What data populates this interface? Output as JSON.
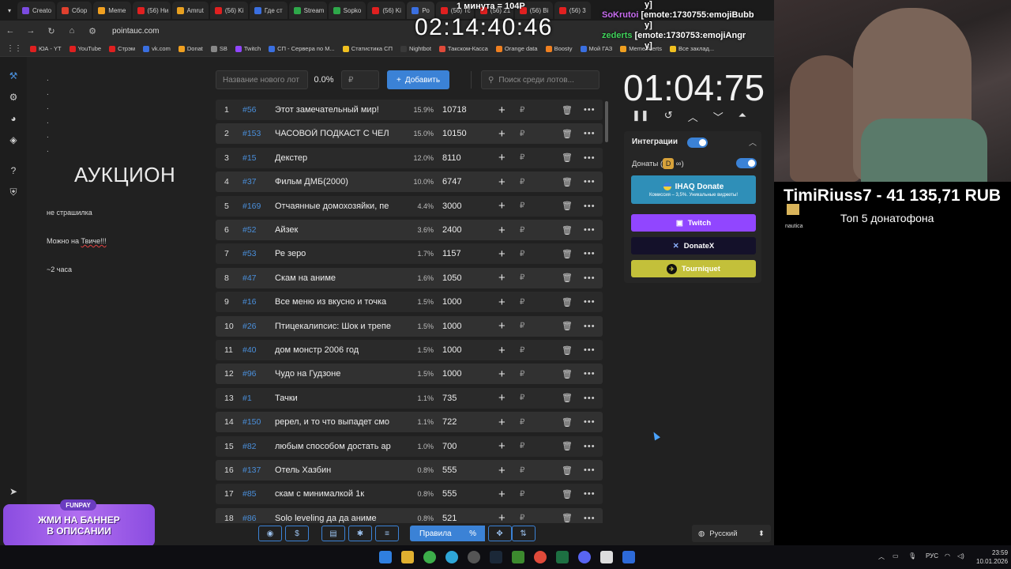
{
  "browser": {
    "tabs": [
      "Creato",
      "Сбор",
      "Meme",
      "(56) Ни",
      "Amrut",
      "(56) Ki",
      "Где ст",
      "Stream",
      "Sopko",
      "(56) Ki",
      "Ро",
      "(56) Тс",
      "(56) 21",
      "(56) Bi",
      "(56) 3"
    ],
    "url": "pointauc.com",
    "bookmarks": [
      "ЮА - YT",
      "YouTube",
      "Стрэм",
      "vk.com",
      "Donat",
      "SB",
      "Twitch",
      "СП - Сервера по М...",
      "Статистика СП",
      "Nightbot",
      "Такском-Касса",
      "Orange data",
      "Boosty",
      "Мой ГАЗ",
      "Meme Alerts",
      "Все заклад..."
    ]
  },
  "overlay": {
    "big_clock": "02:14:40:46",
    "top_note": "1 минута = 104Р",
    "chat": [
      {
        "user": "",
        "text": "y]"
      },
      {
        "user": "SoKrutoi",
        "text": "[emote:1730755:emojiBubb"
      },
      {
        "user": "",
        "text": "y]"
      },
      {
        "user": "zederts",
        "text": "[emote:1730753:emojiAngr"
      },
      {
        "user": "",
        "text": "y]"
      }
    ],
    "donor_line": "TimiRiuss7 - 41 135,71 RUB",
    "top_label": "Топ  5 донатофона",
    "small_label": "nautica",
    "banner_badge": "FUNPAY",
    "banner_line1": "ЖМИ НА БАННЕР",
    "banner_line2": "В ОПИСАНИИ"
  },
  "left": {
    "title": "АУКЦИОН",
    "note1": "не страшилка",
    "note2_prefix": "Можно на ",
    "note2_word": "Твиче!!!",
    "note3": "~2 часа"
  },
  "toolbar": {
    "name_placeholder": "Название нового лот",
    "percent": "0.0%",
    "amount_placeholder": "₽",
    "add_label": "Добавить",
    "search_placeholder": "Поиск среди лотов..."
  },
  "lots": [
    {
      "n": "1",
      "id": "#56",
      "name": "Этот замечательный мир!",
      "pct": "15.9%",
      "amount": "10718"
    },
    {
      "n": "2",
      "id": "#153",
      "name": " ЧАСОВОЙ ПОДКАСТ С ЧЕЛ",
      "pct": "15.0%",
      "amount": "10150"
    },
    {
      "n": "3",
      "id": "#15",
      "name": "Декстер",
      "pct": "12.0%",
      "amount": "8110"
    },
    {
      "n": "4",
      "id": "#37",
      "name": "Фильм ДМБ(2000)",
      "pct": "10.0%",
      "amount": "6747"
    },
    {
      "n": "5",
      "id": "#169",
      "name": " Отчаянные домохозяйки, пе",
      "pct": "4.4%",
      "amount": "3000"
    },
    {
      "n": "6",
      "id": "#52",
      "name": "Айзек",
      "pct": "3.6%",
      "amount": "2400"
    },
    {
      "n": "7",
      "id": "#53",
      "name": "Ре зеро",
      "pct": "1.7%",
      "amount": "1157"
    },
    {
      "n": "8",
      "id": "#47",
      "name": "Скам на аниме",
      "pct": "1.6%",
      "amount": "1050"
    },
    {
      "n": "9",
      "id": "#16",
      "name": "Все меню из вкусно и точка",
      "pct": "1.5%",
      "amount": "1000"
    },
    {
      "n": "10",
      "id": "#26",
      "name": "Птицекалипсис: Шок и трепе",
      "pct": "1.5%",
      "amount": "1000"
    },
    {
      "n": "11",
      "id": "#40",
      "name": "дом монстр 2006 год",
      "pct": "1.5%",
      "amount": "1000"
    },
    {
      "n": "12",
      "id": "#96",
      "name": "Чудо на Гудзоне",
      "pct": "1.5%",
      "amount": "1000"
    },
    {
      "n": "13",
      "id": "#1",
      "name": "Тачки",
      "pct": "1.1%",
      "amount": "735"
    },
    {
      "n": "14",
      "id": "#150",
      "name": " ререл, и то что выпадет смо",
      "pct": "1.1%",
      "amount": "722"
    },
    {
      "n": "15",
      "id": "#82",
      "name": "любым способом достать ар",
      "pct": "1.0%",
      "amount": "700"
    },
    {
      "n": "16",
      "id": "#137",
      "name": " Отель Хазбин",
      "pct": "0.8%",
      "amount": "555"
    },
    {
      "n": "17",
      "id": "#85",
      "name": "скам с минималкой 1к",
      "pct": "0.8%",
      "amount": "555"
    },
    {
      "n": "18",
      "id": "#86",
      "name": "Solo leveling да да аниме",
      "pct": "0.8%",
      "amount": "521"
    }
  ],
  "row_symbols": {
    "plus": "+",
    "rub": "₽",
    "trash": "🗑",
    "more": "•••"
  },
  "timer": {
    "value": "01:04:75"
  },
  "integrations": {
    "header": "Интеграции",
    "donations_label": "Донаты (",
    "donations_close": ")",
    "ihaq_title": "IHAQ Donate",
    "ihaq_sub": "Комиссия – 3,5%. Уникальные виджеты!",
    "twitch": "Twitch",
    "donatex": "DonateX",
    "tourniquet": "Tourniquet"
  },
  "bottom": {
    "rules": "Правила",
    "percent_btn": "%"
  },
  "language": "Русский",
  "system": {
    "lang": "РУС",
    "time": "23:59",
    "date": "10.01.2026"
  },
  "colors": {
    "accent": "#3b82d6",
    "twitch": "#9146ff",
    "donatex": "#14112a",
    "tourniquet": "#c3c03a",
    "ihaq": "#2f8fb8"
  }
}
